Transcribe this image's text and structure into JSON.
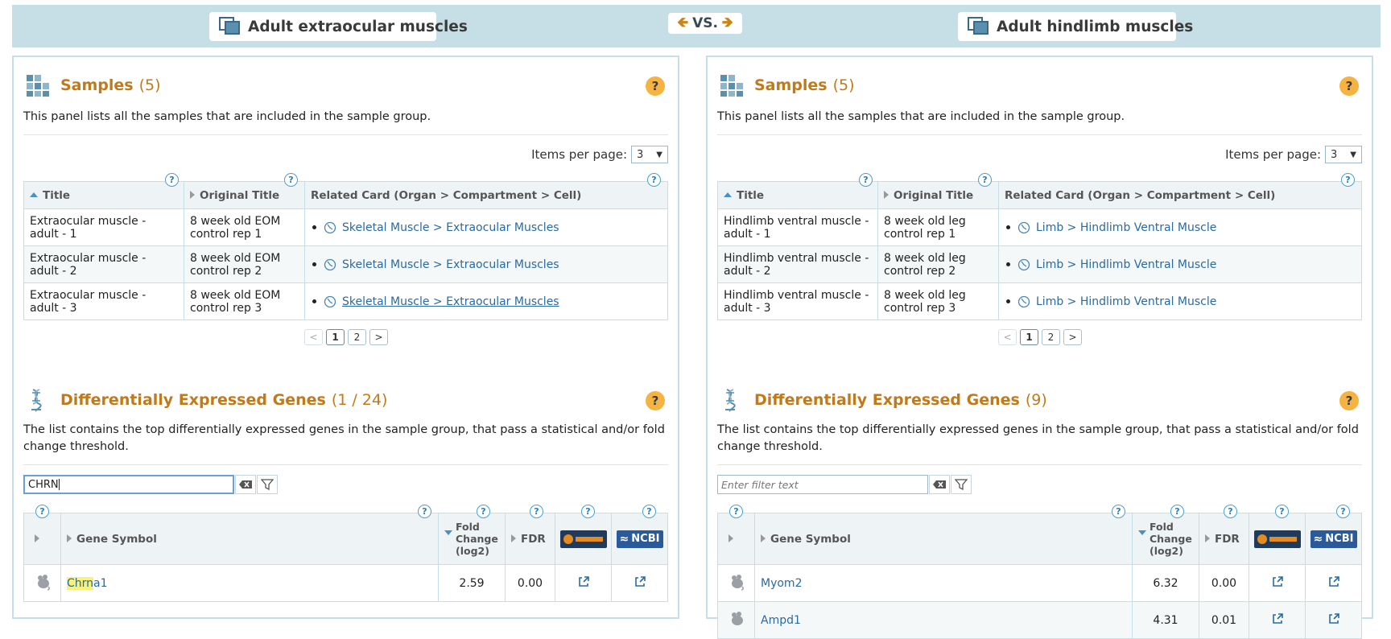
{
  "header": {
    "left_group": "Adult extraocular muscles",
    "vs_label": "VS.",
    "right_group": "Adult hindlimb muscles"
  },
  "left": {
    "samples": {
      "title": "Samples",
      "count": "(5)",
      "description": "This panel lists all the samples that are included in the sample group.",
      "items_per_page_label": "Items per page:",
      "items_per_page": "3",
      "columns": [
        "Title",
        "Original Title",
        "Related Card (Organ > Compartment > Cell)"
      ],
      "rows": [
        {
          "title": "Extraocular muscle - adult - 1",
          "original": "8 week old EOM control rep 1",
          "card": "Skeletal Muscle > Extraocular Muscles"
        },
        {
          "title": "Extraocular muscle - adult - 2",
          "original": "8 week old EOM control rep 2",
          "card": "Skeletal Muscle > Extraocular Muscles"
        },
        {
          "title": "Extraocular muscle - adult - 3",
          "original": "8 week old EOM control rep 3",
          "card": "Skeletal Muscle > Extraocular Muscles"
        }
      ],
      "pager": {
        "prev": "<",
        "pages": [
          "1",
          "2"
        ],
        "next": ">"
      }
    },
    "genes": {
      "title": "Differentially Expressed Genes",
      "count": "(1 / 24)",
      "description": "The list contains the top differentially expressed genes in the sample group, that pass a statistical and/or fold change threshold.",
      "filter_value": "CHRN",
      "columns": {
        "symbol": "Gene Symbol",
        "fold": "Fold Change (log2)",
        "fdr": "FDR",
        "ncbi": "NCBI"
      },
      "rows": [
        {
          "symbol_hl": "Chrn",
          "symbol_rest": "a1",
          "fold": "2.59",
          "fdr": "0.00"
        }
      ]
    }
  },
  "right": {
    "samples": {
      "title": "Samples",
      "count": "(5)",
      "description": "This panel lists all the samples that are included in the sample group.",
      "items_per_page_label": "Items per page:",
      "items_per_page": "3",
      "columns": [
        "Title",
        "Original Title",
        "Related Card (Organ > Compartment > Cell)"
      ],
      "rows": [
        {
          "title": "Hindlimb ventral muscle - adult - 1",
          "original": "8 week old leg control rep 1",
          "card": "Limb > Hindlimb Ventral Muscle"
        },
        {
          "title": "Hindlimb ventral muscle - adult - 2",
          "original": "8 week old leg control rep 2",
          "card": "Limb > Hindlimb Ventral Muscle"
        },
        {
          "title": "Hindlimb ventral muscle - adult - 3",
          "original": "8 week old leg control rep 3",
          "card": "Limb > Hindlimb Ventral Muscle"
        }
      ],
      "pager": {
        "prev": "<",
        "pages": [
          "1",
          "2"
        ],
        "next": ">"
      }
    },
    "genes": {
      "title": "Differentially Expressed Genes",
      "count": "(9)",
      "description": "The list contains the top differentially expressed genes in the sample group, that pass a statistical and/or fold change threshold.",
      "filter_placeholder": "Enter filter text",
      "columns": {
        "symbol": "Gene Symbol",
        "fold": "Fold Change (log2)",
        "fdr": "FDR",
        "ncbi": "NCBI"
      },
      "rows": [
        {
          "symbol": "Myom2",
          "fold": "6.32",
          "fdr": "0.00"
        },
        {
          "symbol": "Ampd1",
          "fold": "4.31",
          "fdr": "0.01"
        }
      ]
    }
  },
  "colors": {
    "accent_orange": "#c17a1a",
    "panel_border": "#c6dee5",
    "link_blue": "#2b6a9e",
    "help_yellow": "#f5b342"
  }
}
